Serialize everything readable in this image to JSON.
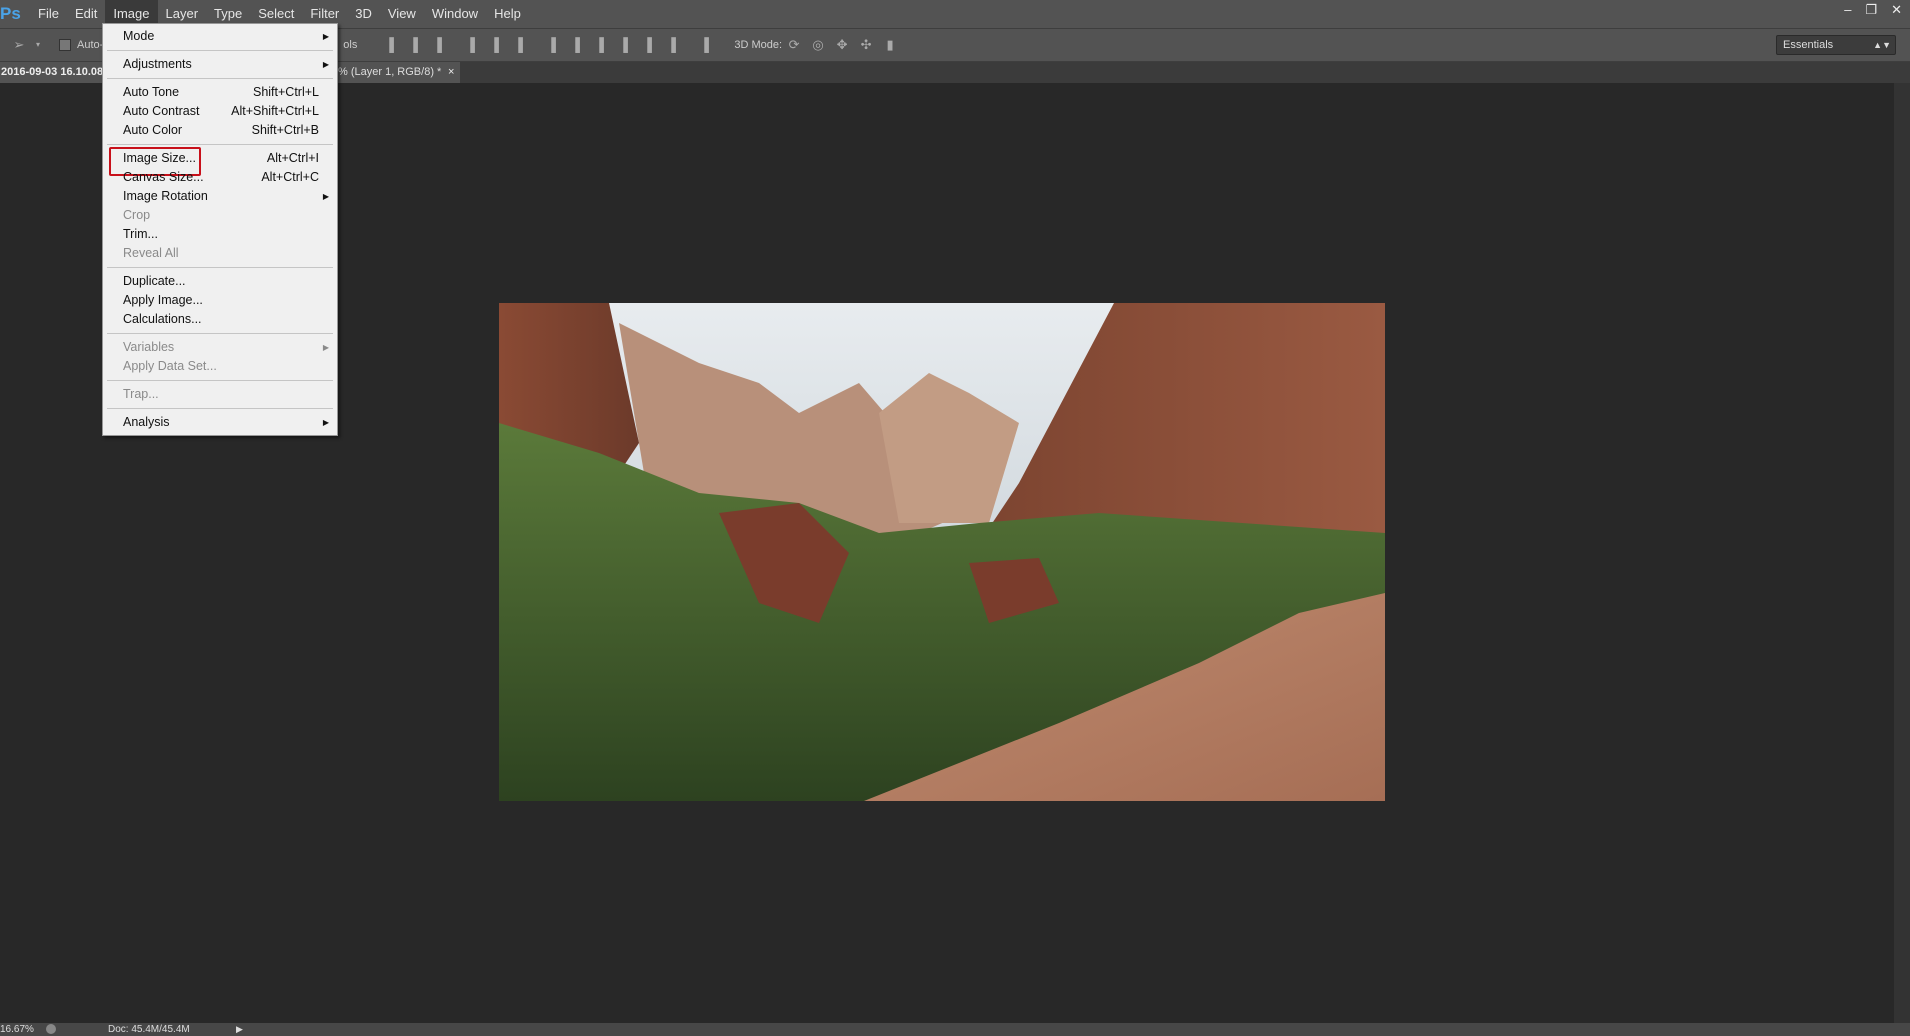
{
  "app": {
    "logo": "Ps"
  },
  "menubar": [
    "File",
    "Edit",
    "Image",
    "Layer",
    "Type",
    "Select",
    "Filter",
    "3D",
    "View",
    "Window",
    "Help"
  ],
  "window_controls": [
    "minimize",
    "restore",
    "close"
  ],
  "toolbar": {
    "auto_select_label": "Auto-",
    "show_transform_suffix": "ols",
    "mode_3d_label": "3D Mode:",
    "workspace": "Essentials"
  },
  "tab": {
    "title_left": "2016-09-03 16.10.08",
    "title_right": "% (Layer 1, RGB/8) *",
    "close": "×"
  },
  "image_menu": [
    {
      "label": "Mode",
      "submenu": true
    },
    {
      "sep": true
    },
    {
      "label": "Adjustments",
      "submenu": true
    },
    {
      "sep": true
    },
    {
      "label": "Auto Tone",
      "shortcut": "Shift+Ctrl+L"
    },
    {
      "label": "Auto Contrast",
      "shortcut": "Alt+Shift+Ctrl+L"
    },
    {
      "label": "Auto Color",
      "shortcut": "Shift+Ctrl+B"
    },
    {
      "sep": true
    },
    {
      "label": "Image Size...",
      "shortcut": "Alt+Ctrl+I",
      "highlighted": true
    },
    {
      "label": "Canvas Size...",
      "shortcut": "Alt+Ctrl+C"
    },
    {
      "label": "Image Rotation",
      "submenu": true
    },
    {
      "label": "Crop",
      "disabled": true
    },
    {
      "label": "Trim..."
    },
    {
      "label": "Reveal All",
      "disabled": true
    },
    {
      "sep": true
    },
    {
      "label": "Duplicate..."
    },
    {
      "label": "Apply Image..."
    },
    {
      "label": "Calculations..."
    },
    {
      "sep": true
    },
    {
      "label": "Variables",
      "submenu": true,
      "disabled": true
    },
    {
      "label": "Apply Data Set...",
      "disabled": true
    },
    {
      "sep": true
    },
    {
      "label": "Trap...",
      "disabled": true
    },
    {
      "sep": true
    },
    {
      "label": "Analysis",
      "submenu": true
    }
  ],
  "status": {
    "zoom": "16.67%",
    "doc": "Doc: 45.4M/45.4M"
  },
  "colors": {
    "highlight": "#c8101a",
    "chrome": "#535353",
    "canvas": "#282828"
  }
}
